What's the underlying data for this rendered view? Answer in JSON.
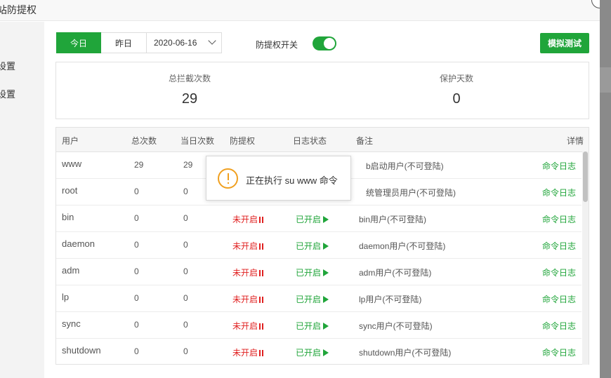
{
  "window": {
    "title": "站防提权"
  },
  "sidebar": {
    "items": [
      {
        "label": "设置"
      },
      {
        "label": "设置"
      }
    ]
  },
  "toolbar": {
    "today_label": "今日",
    "yesterday_label": "昨日",
    "date_value": "2020-06-16",
    "switch_label": "防提权开关",
    "switch_on": true,
    "simulate_label": "模拟测试"
  },
  "stats": {
    "total_label": "总拦截次数",
    "total_value": "29",
    "days_label": "保护天数",
    "days_value": "0"
  },
  "table": {
    "headers": {
      "user": "用户",
      "total": "总次数",
      "today": "当日次数",
      "protect": "防提权",
      "log": "日志状态",
      "note": "备注",
      "detail": "详情"
    },
    "rows": [
      {
        "user": "www",
        "total": "29",
        "today": "29",
        "protect": "",
        "log": "",
        "note": "b启动用户(不可登陆)",
        "detail": "命令日志"
      },
      {
        "user": "root",
        "total": "0",
        "today": "0",
        "protect": "",
        "log": "",
        "note": "统管理员用户(不可登陆)",
        "detail": "命令日志"
      },
      {
        "user": "bin",
        "total": "0",
        "today": "0",
        "protect": "未开启",
        "log": "已开启",
        "note": "bin用户(不可登陆)",
        "detail": "命令日志"
      },
      {
        "user": "daemon",
        "total": "0",
        "today": "0",
        "protect": "未开启",
        "log": "已开启",
        "note": "daemon用户(不可登陆)",
        "detail": "命令日志"
      },
      {
        "user": "adm",
        "total": "0",
        "today": "0",
        "protect": "未开启",
        "log": "已开启",
        "note": "adm用户(不可登陆)",
        "detail": "命令日志"
      },
      {
        "user": "lp",
        "total": "0",
        "today": "0",
        "protect": "未开启",
        "log": "已开启",
        "note": "lp用户(不可登陆)",
        "detail": "命令日志"
      },
      {
        "user": "sync",
        "total": "0",
        "today": "0",
        "protect": "未开启",
        "log": "已开启",
        "note": "sync用户(不可登陆)",
        "detail": "命令日志"
      },
      {
        "user": "shutdown",
        "total": "0",
        "today": "0",
        "protect": "未开启",
        "log": "已开启",
        "note": "shutdown用户(不可登陆)",
        "detail": "命令日志"
      }
    ]
  },
  "toast": {
    "message": "正在执行 su www 命令"
  },
  "colors": {
    "accent": "#20a53a",
    "danger": "#e02020",
    "warning": "#f0a020"
  },
  "icons": {
    "toast": "warning-icon",
    "protect": "pause-icon",
    "log": "play-icon",
    "date": "chevron-down-icon"
  }
}
